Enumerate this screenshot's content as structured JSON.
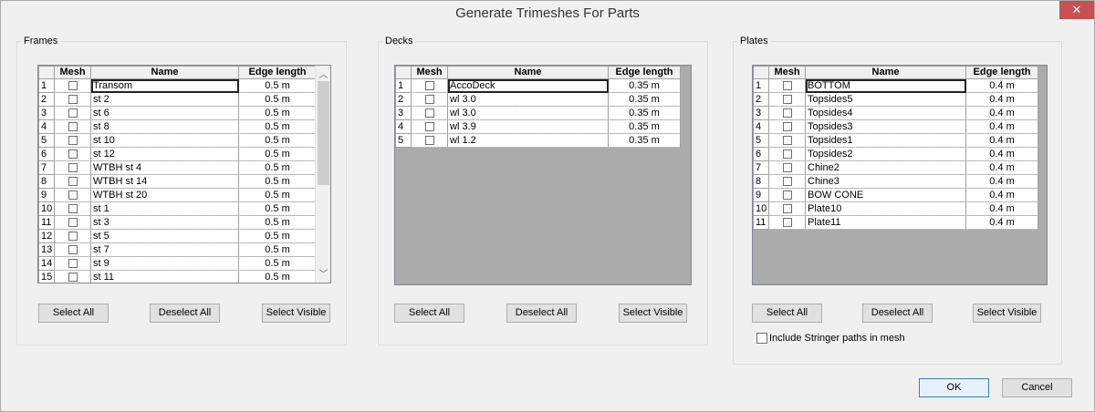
{
  "window": {
    "title": "Generate Trimeshes For Parts",
    "close_glyph": "✕"
  },
  "columns": {
    "mesh": "Mesh",
    "name": "Name",
    "edge": "Edge length"
  },
  "frames": {
    "legend": "Frames",
    "rows": [
      {
        "n": "1",
        "name": "Transom",
        "edge": "0.5 m"
      },
      {
        "n": "2",
        "name": "st 2",
        "edge": "0.5 m"
      },
      {
        "n": "3",
        "name": "st 6",
        "edge": "0.5 m"
      },
      {
        "n": "4",
        "name": "st 8",
        "edge": "0.5 m"
      },
      {
        "n": "5",
        "name": "st 10",
        "edge": "0.5 m"
      },
      {
        "n": "6",
        "name": "st 12",
        "edge": "0.5 m"
      },
      {
        "n": "7",
        "name": "WTBH st 4",
        "edge": "0.5 m"
      },
      {
        "n": "8",
        "name": "WTBH st 14",
        "edge": "0.5 m"
      },
      {
        "n": "9",
        "name": "WTBH st 20",
        "edge": "0.5 m"
      },
      {
        "n": "10",
        "name": "st 1",
        "edge": "0.5 m"
      },
      {
        "n": "11",
        "name": "st 3",
        "edge": "0.5 m"
      },
      {
        "n": "12",
        "name": "st 5",
        "edge": "0.5 m"
      },
      {
        "n": "13",
        "name": "st 7",
        "edge": "0.5 m"
      },
      {
        "n": "14",
        "name": "st 9",
        "edge": "0.5 m"
      },
      {
        "n": "15",
        "name": "st 11",
        "edge": "0.5 m"
      }
    ],
    "select_all": "Select All",
    "deselect_all": "Deselect All",
    "select_visible": "Select Visible"
  },
  "decks": {
    "legend": "Decks",
    "rows": [
      {
        "n": "1",
        "name": "AccoDeck",
        "edge": "0.35 m"
      },
      {
        "n": "2",
        "name": "wl 3.0",
        "edge": "0.35 m"
      },
      {
        "n": "3",
        "name": "wl 3.0",
        "edge": "0.35 m"
      },
      {
        "n": "4",
        "name": "wl 3.9",
        "edge": "0.35 m"
      },
      {
        "n": "5",
        "name": "wl 1.2",
        "edge": "0.35 m"
      }
    ],
    "select_all": "Select All",
    "deselect_all": "Deselect All",
    "select_visible": "Select Visible"
  },
  "plates": {
    "legend": "Plates",
    "rows": [
      {
        "n": "1",
        "name": "BOTTOM",
        "edge": "0.4 m"
      },
      {
        "n": "2",
        "name": "Topsides5",
        "edge": "0.4 m"
      },
      {
        "n": "3",
        "name": "Topsides4",
        "edge": "0.4 m"
      },
      {
        "n": "4",
        "name": "Topsides3",
        "edge": "0.4 m"
      },
      {
        "n": "5",
        "name": "Topsides1",
        "edge": "0.4 m"
      },
      {
        "n": "6",
        "name": "Topsides2",
        "edge": "0.4 m"
      },
      {
        "n": "7",
        "name": "Chine2",
        "edge": "0.4 m"
      },
      {
        "n": "8",
        "name": "Chine3",
        "edge": "0.4 m"
      },
      {
        "n": "9",
        "name": "BOW CONE",
        "edge": "0.4 m"
      },
      {
        "n": "10",
        "name": "Plate10",
        "edge": "0.4 m"
      },
      {
        "n": "11",
        "name": "Plate11",
        "edge": "0.4 m"
      }
    ],
    "select_all": "Select All",
    "deselect_all": "Deselect All",
    "select_visible": "Select Visible",
    "stringer_label": "Include Stringer paths in mesh"
  },
  "footer": {
    "ok": "OK",
    "cancel": "Cancel"
  },
  "scroll": {
    "up": "︿",
    "down": "﹀"
  }
}
